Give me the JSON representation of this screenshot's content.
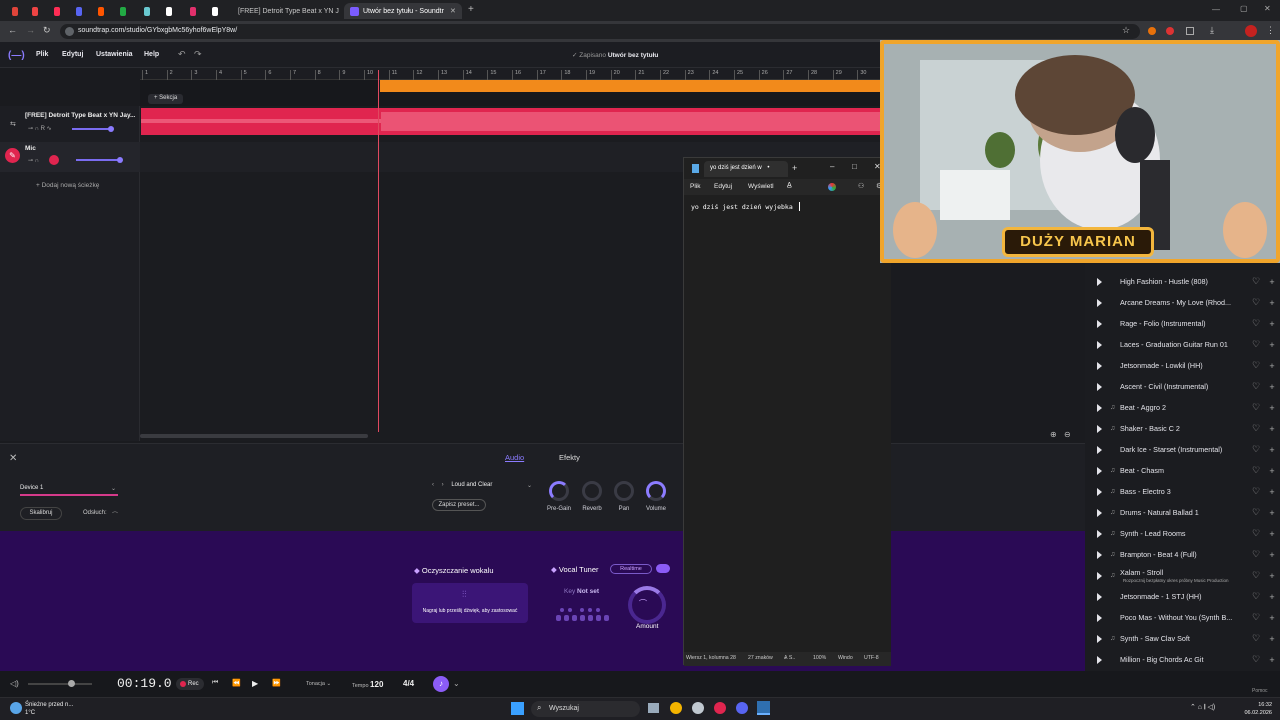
{
  "browser": {
    "tabs": [
      {
        "label": "",
        "color": "#e0443a"
      },
      {
        "label": "",
        "color": "#e44"
      },
      {
        "label": "",
        "color": "#ff2d55"
      },
      {
        "label": "",
        "color": "#5865f2"
      },
      {
        "label": "",
        "color": "#ff5500"
      },
      {
        "label": "",
        "color": "#22aa44"
      },
      {
        "label": "",
        "color": "#69c9d0"
      },
      {
        "label": "",
        "color": "#ffffff"
      },
      {
        "label": "",
        "color": "#e1306c"
      },
      {
        "label": "",
        "color": "#ffffff"
      },
      {
        "label": "[FREE] Detroit Type Beat x YN J",
        "color": "#ff0000"
      },
      {
        "label": "Utwór bez tytułu - Soundtr",
        "color": "#7b5cff"
      }
    ],
    "url": "soundtrap.com/studio/GYbxgbMc56yhof6wElpY8w/"
  },
  "app": {
    "menu": [
      "Plik",
      "Edytuj",
      "Ustawienia",
      "Help"
    ],
    "save_status": "Zapisano",
    "title": "Utwór bez tytułu",
    "section_button": "+ Sekcja",
    "ruler_marks": [
      "1",
      "2",
      "3",
      "4",
      "5",
      "6",
      "7",
      "8",
      "9",
      "10",
      "11",
      "12",
      "13",
      "14",
      "15",
      "16",
      "17",
      "18",
      "19",
      "20",
      "21",
      "22",
      "23",
      "24",
      "25",
      "26",
      "27",
      "28",
      "29",
      "30"
    ],
    "tracks": [
      {
        "name": "[FREE] Detroit Type Beat x YN Jay..."
      },
      {
        "name": "Mic"
      }
    ],
    "add_track": "+ Dodaj nową ścieżkę"
  },
  "bottom": {
    "tabs": [
      "Audio",
      "Efekty"
    ],
    "device": "Device 1",
    "calibrate": "Skalibruj",
    "monitor": "Odsłuch:",
    "preset": "Loud and Clear",
    "save_preset": "Zapisz preset...",
    "knobs": [
      "Pre-Gain",
      "Reverb",
      "Pan",
      "Volume"
    ]
  },
  "vocal": {
    "clean_title": "Oczyszczanie wokalu",
    "clean_hint": "Nagraj lub prześlij dźwięk, aby zastosować",
    "tuner_title": "Vocal Tuner",
    "tuner_mode": "Realtime",
    "key_label": "Key",
    "key_value": "Not set",
    "amount": "Amount"
  },
  "transport": {
    "time": "00:19.0",
    "rec": "Rec",
    "key_label": "Tonacja",
    "tempo_label": "Tempo",
    "tempo": "120",
    "meter": "4/4"
  },
  "notepad": {
    "tab_title": "yo dziś jest dzień w",
    "menu": [
      "Plik",
      "Edytuj",
      "Wyświetl"
    ],
    "text": "yo dziś jest dzień wyjebka",
    "status": [
      "Wiersz 1, kolumna 28",
      "27 znaków",
      "100%",
      "Windo",
      "UTF-8"
    ]
  },
  "webcam": {
    "name_banner": "DUŻY MARIAN"
  },
  "library": {
    "rows": [
      {
        "title": "High Fashion - Hustle (808)",
        "icon": "play"
      },
      {
        "title": "Arcane Dreams - My Love (Rhod...",
        "icon": "play"
      },
      {
        "title": "Rage - Folio (Instrumental)",
        "icon": "play"
      },
      {
        "title": "Laces - Graduation Guitar Run 01",
        "icon": "play"
      },
      {
        "title": "Jetsonmade - Lowkil (HH)",
        "icon": "play"
      },
      {
        "title": "Ascent - Civil (Instrumental)",
        "icon": "play"
      },
      {
        "title": "Beat - Aggro 2",
        "icon": "note"
      },
      {
        "title": "Shaker - Basic C 2",
        "icon": "note"
      },
      {
        "title": "Dark Ice - Starset (Instrumental)",
        "icon": "play"
      },
      {
        "title": "Beat - Chasm",
        "icon": "note"
      },
      {
        "title": "Bass - Electro 3",
        "icon": "note"
      },
      {
        "title": "Drums - Natural Ballad 1",
        "icon": "note"
      },
      {
        "title": "Synth - Lead Rooms",
        "icon": "note"
      },
      {
        "title": "Brampton - Beat 4 (Full)",
        "icon": "note"
      },
      {
        "title": "Xalam - Stroll",
        "icon": "note",
        "sub": "Rozpocznij bezpłatny okres próbny Music Production"
      },
      {
        "title": "Jetsonmade - 1 STJ (HH)",
        "icon": "play"
      },
      {
        "title": "Poco Mas - Without You (Synth B...",
        "icon": "play"
      },
      {
        "title": "Synth - Saw Clav Soft",
        "icon": "note"
      },
      {
        "title": "Million - Big Chords Ac Git",
        "icon": "play"
      }
    ],
    "help": "Pomoc"
  },
  "taskbar": {
    "weather_title": "Śnieżne przed n...",
    "weather_temp": "1°C",
    "search": "Wyszukaj",
    "time": "16:32",
    "date": "06.02.2026"
  }
}
